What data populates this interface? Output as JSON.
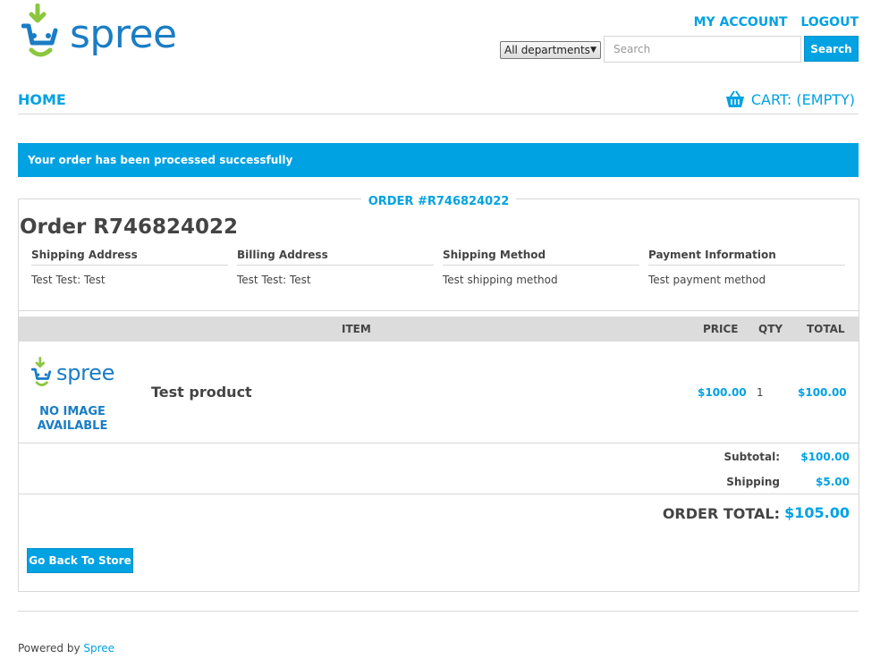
{
  "brand": {
    "logo_text": "spree",
    "color": "#1a7dc4",
    "accent": "#00a2e2",
    "green": "#8cc63f"
  },
  "header": {
    "my_account": "MY ACCOUNT",
    "logout": "LOGOUT",
    "department_select": "All departments",
    "search_placeholder": "Search",
    "search_button": "Search"
  },
  "nav": {
    "home": "HOME",
    "cart": "CART: (EMPTY)",
    "cart_icon": "basket-icon"
  },
  "flash": "Your order has been processed successfully",
  "order": {
    "legend": "ORDER #R746824022",
    "title": "Order R746824022",
    "info": [
      {
        "heading": "Shipping Address",
        "value": "Test Test: Test"
      },
      {
        "heading": "Billing Address",
        "value": "Test Test: Test"
      },
      {
        "heading": "Shipping Method",
        "value": "Test shipping method"
      },
      {
        "heading": "Payment Information",
        "value": "Test payment method"
      }
    ],
    "columns": {
      "item": "ITEM",
      "price": "PRICE",
      "qty": "QTY",
      "total": "TOTAL"
    },
    "line_items": [
      {
        "thumb_logo": "spree",
        "thumb_text": "NO IMAGE AVAILABLE",
        "name": "Test product",
        "price": "$100.00",
        "qty": "1",
        "total": "$100.00"
      }
    ],
    "subtotal_label": "Subtotal:",
    "subtotal": "$100.00",
    "shipping_label": "Shipping",
    "shipping": "$5.00",
    "order_total_label": "ORDER TOTAL:",
    "order_total": "$105.00",
    "back_button": "Go Back To Store"
  },
  "footer": {
    "prefix": "Powered by",
    "link": "Spree"
  }
}
